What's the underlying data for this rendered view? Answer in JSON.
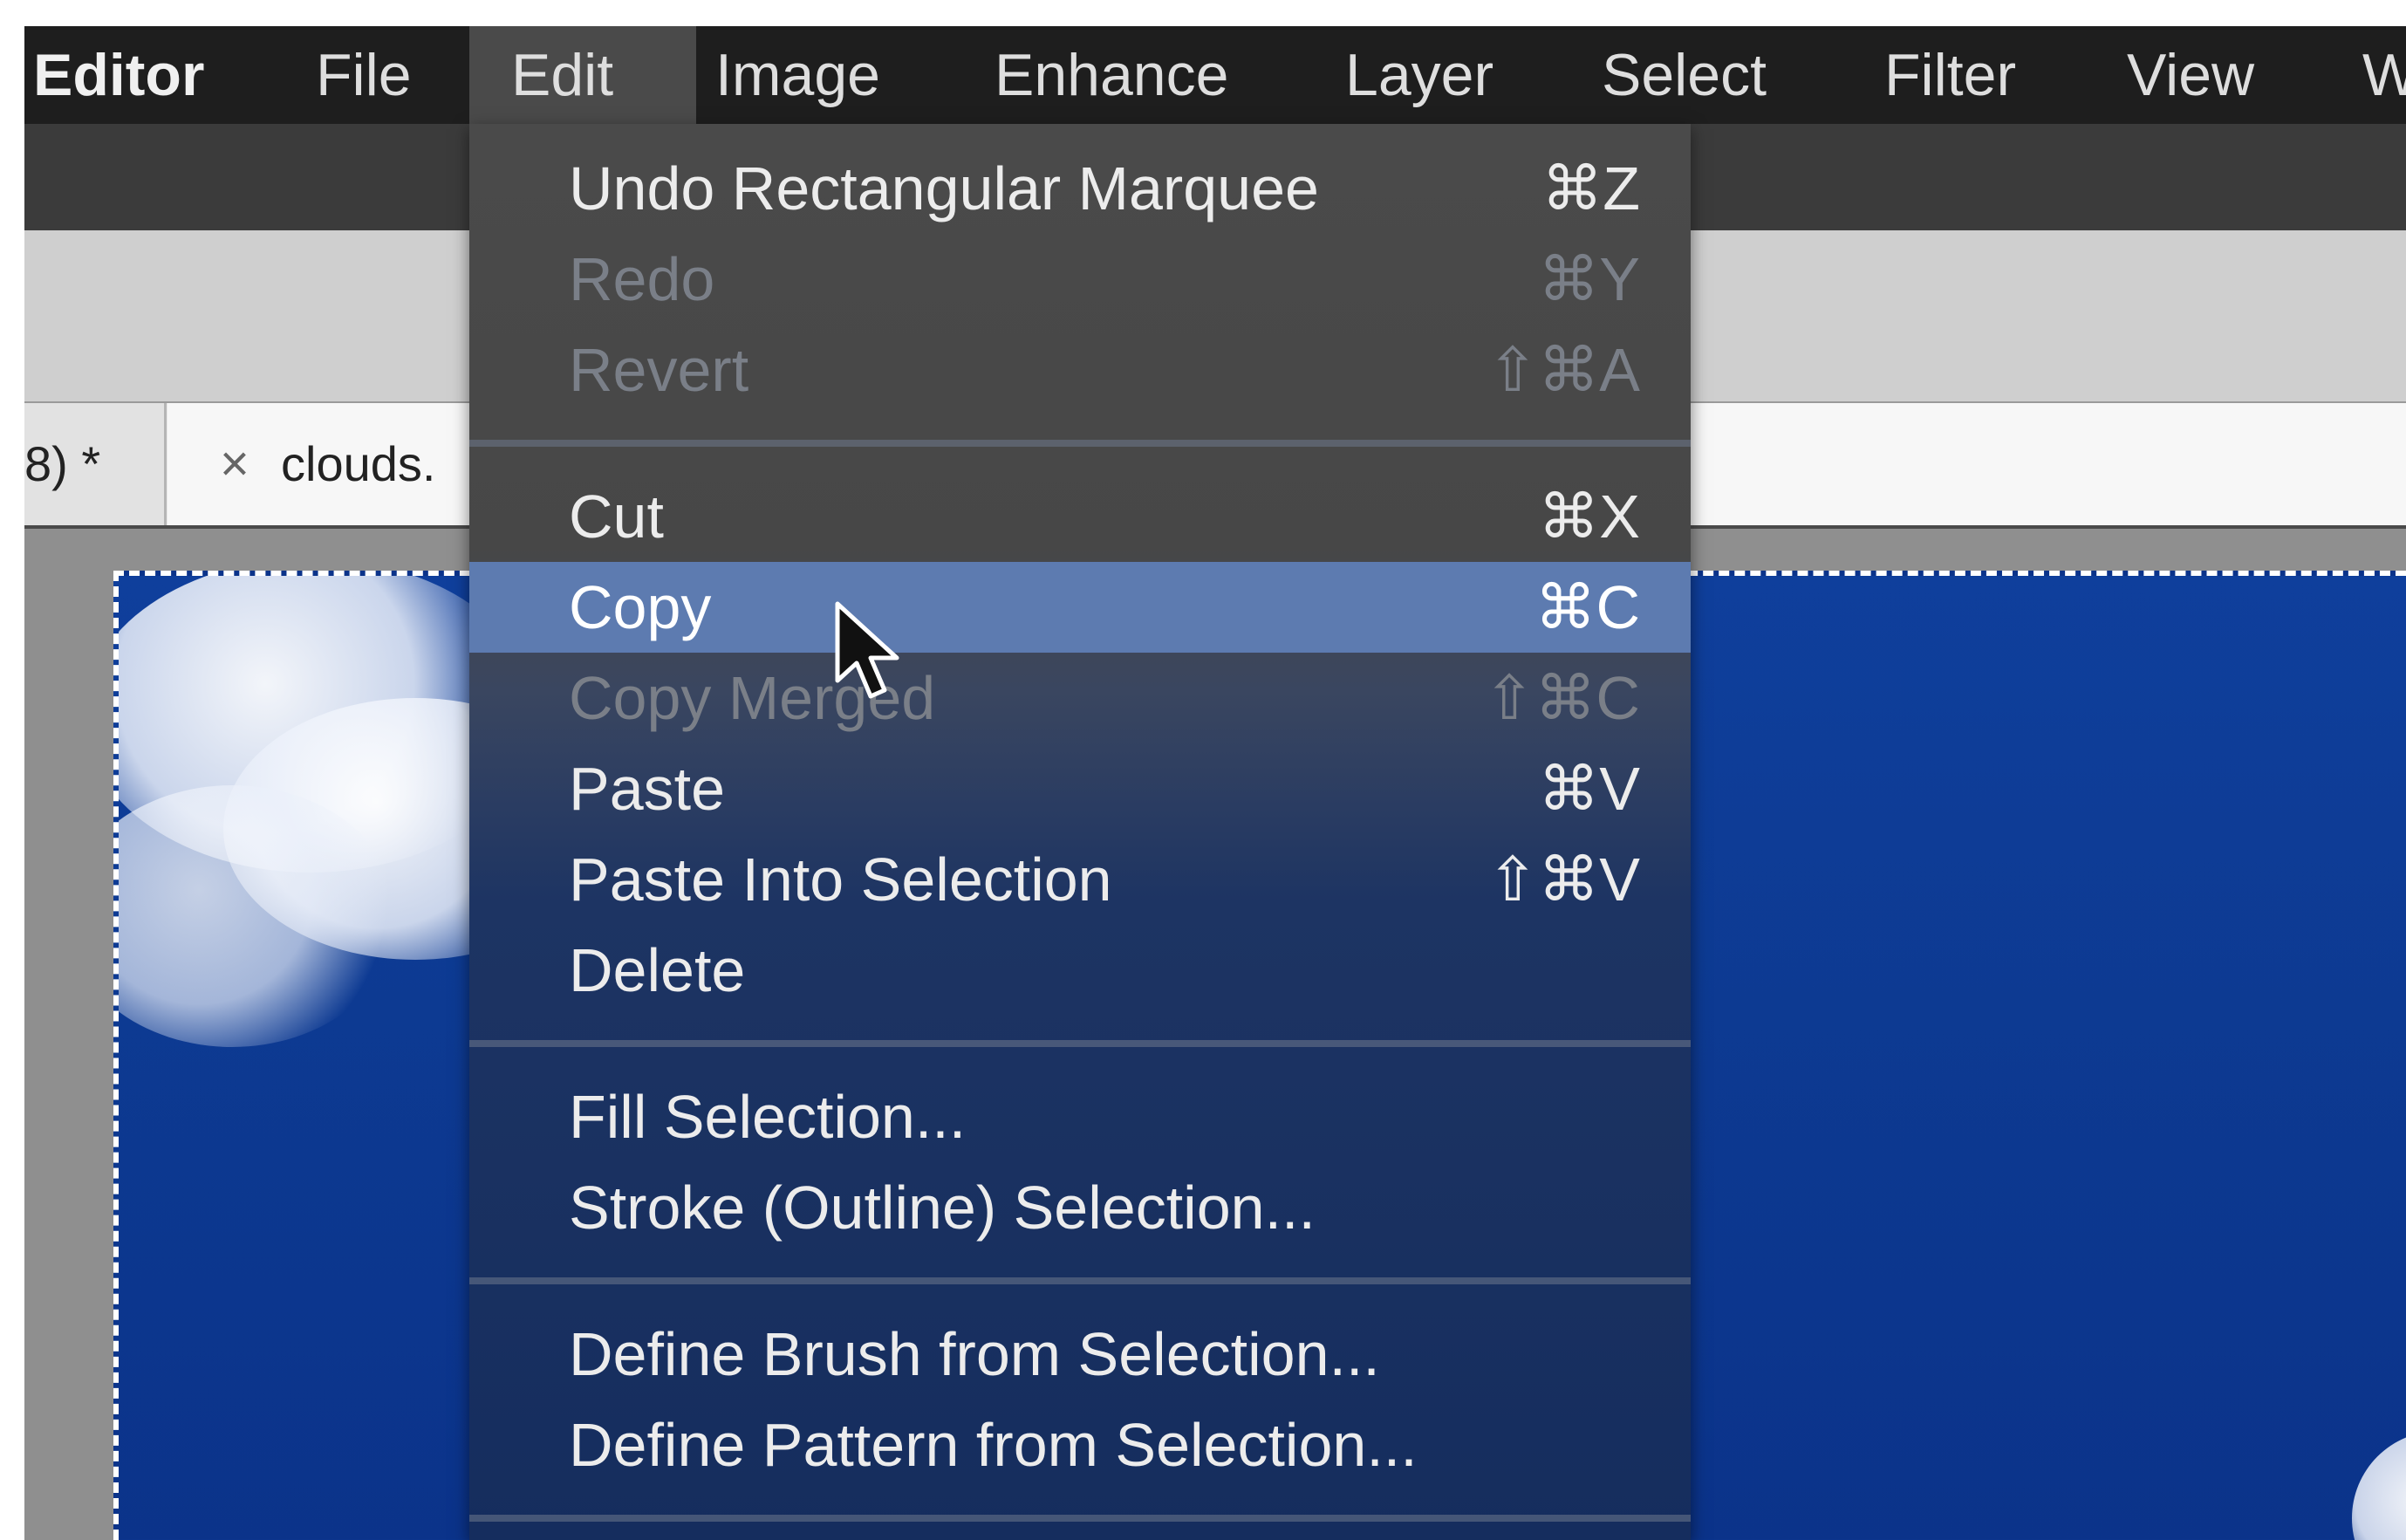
{
  "menubar": {
    "items": [
      {
        "label": "Editor"
      },
      {
        "label": "File"
      },
      {
        "label": "Edit"
      },
      {
        "label": "Image"
      },
      {
        "label": "Enhance"
      },
      {
        "label": "Layer"
      },
      {
        "label": "Select"
      },
      {
        "label": "Filter"
      },
      {
        "label": "View"
      },
      {
        "label": "W"
      }
    ],
    "active": "Edit"
  },
  "tabs": [
    {
      "title": "8) *"
    },
    {
      "close": "×",
      "title": "clouds."
    }
  ],
  "edit_menu": {
    "items": [
      {
        "label": "Undo Rectangular Marquee",
        "shortcut": "⌘Z",
        "enabled": true
      },
      {
        "label": "Redo",
        "shortcut": "⌘Y",
        "enabled": false
      },
      {
        "label": "Revert",
        "shortcut": "⇧⌘A",
        "enabled": false
      },
      {
        "label": "Cut",
        "shortcut": "⌘X",
        "enabled": true
      },
      {
        "label": "Copy",
        "shortcut": "⌘C",
        "enabled": true,
        "highlighted": true
      },
      {
        "label": "Copy Merged",
        "shortcut": "⇧⌘C",
        "enabled": false
      },
      {
        "label": "Paste",
        "shortcut": "⌘V",
        "enabled": true
      },
      {
        "label": "Paste Into Selection",
        "shortcut": "⇧⌘V",
        "enabled": true
      },
      {
        "label": "Delete",
        "shortcut": "",
        "enabled": true
      },
      {
        "label": "Fill Selection...",
        "shortcut": "",
        "enabled": true
      },
      {
        "label": "Stroke (Outline) Selection...",
        "shortcut": "",
        "enabled": true
      },
      {
        "label": "Define Brush from Selection...",
        "shortcut": "",
        "enabled": true
      },
      {
        "label": "Define Pattern from Selection...",
        "shortcut": "",
        "enabled": true
      }
    ]
  },
  "colors": {
    "menubar_bg": "#1e1e1e",
    "menu_highlight": "#5d7bb0",
    "canvas_sky": "#0d3a92"
  }
}
